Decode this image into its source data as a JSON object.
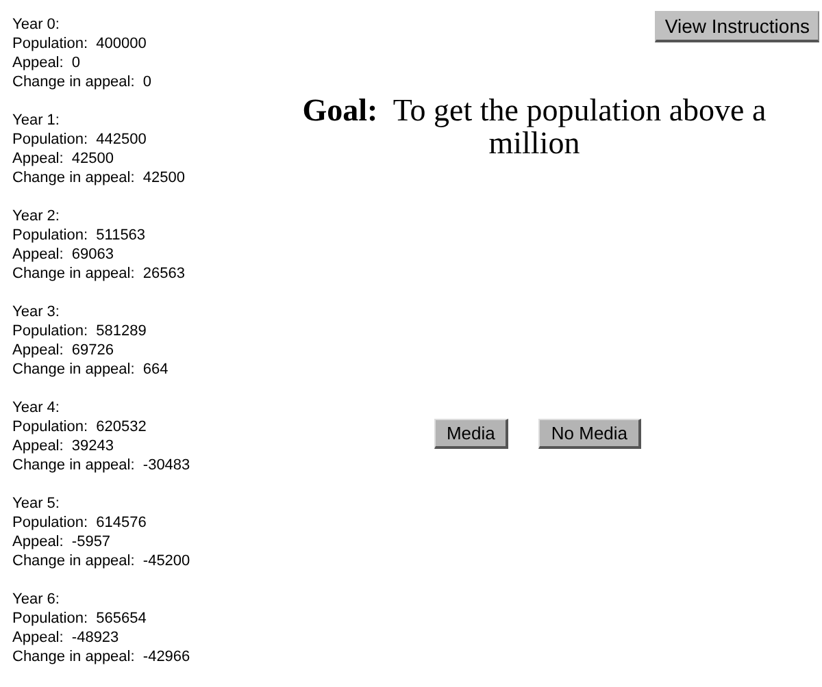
{
  "years": [
    {
      "heading": "Year 0:",
      "population": "Population:  400000",
      "appeal": "Appeal:  0",
      "change": "Change in appeal:  0"
    },
    {
      "heading": "Year 1:",
      "population": "Population:  442500",
      "appeal": "Appeal:  42500",
      "change": "Change in appeal:  42500"
    },
    {
      "heading": "Year 2:",
      "population": "Population:  511563",
      "appeal": "Appeal:  69063",
      "change": "Change in appeal:  26563"
    },
    {
      "heading": "Year 3:",
      "population": "Population:  581289",
      "appeal": "Appeal:  69726",
      "change": "Change in appeal:  664"
    },
    {
      "heading": "Year 4:",
      "population": "Population:  620532",
      "appeal": "Appeal:  39243",
      "change": "Change in appeal:  -30483"
    },
    {
      "heading": "Year 5:",
      "population": "Population:  614576",
      "appeal": "Appeal:  -5957",
      "change": "Change in appeal:  -45200"
    },
    {
      "heading": "Year 6:",
      "population": "Population:  565654",
      "appeal": "Appeal:  -48923",
      "change": "Change in appeal:  -42966"
    }
  ],
  "instructions_button": "View Instructions",
  "goal": "**Goal:**  To get the population above a million",
  "choices": [
    "Media",
    "No Media"
  ]
}
